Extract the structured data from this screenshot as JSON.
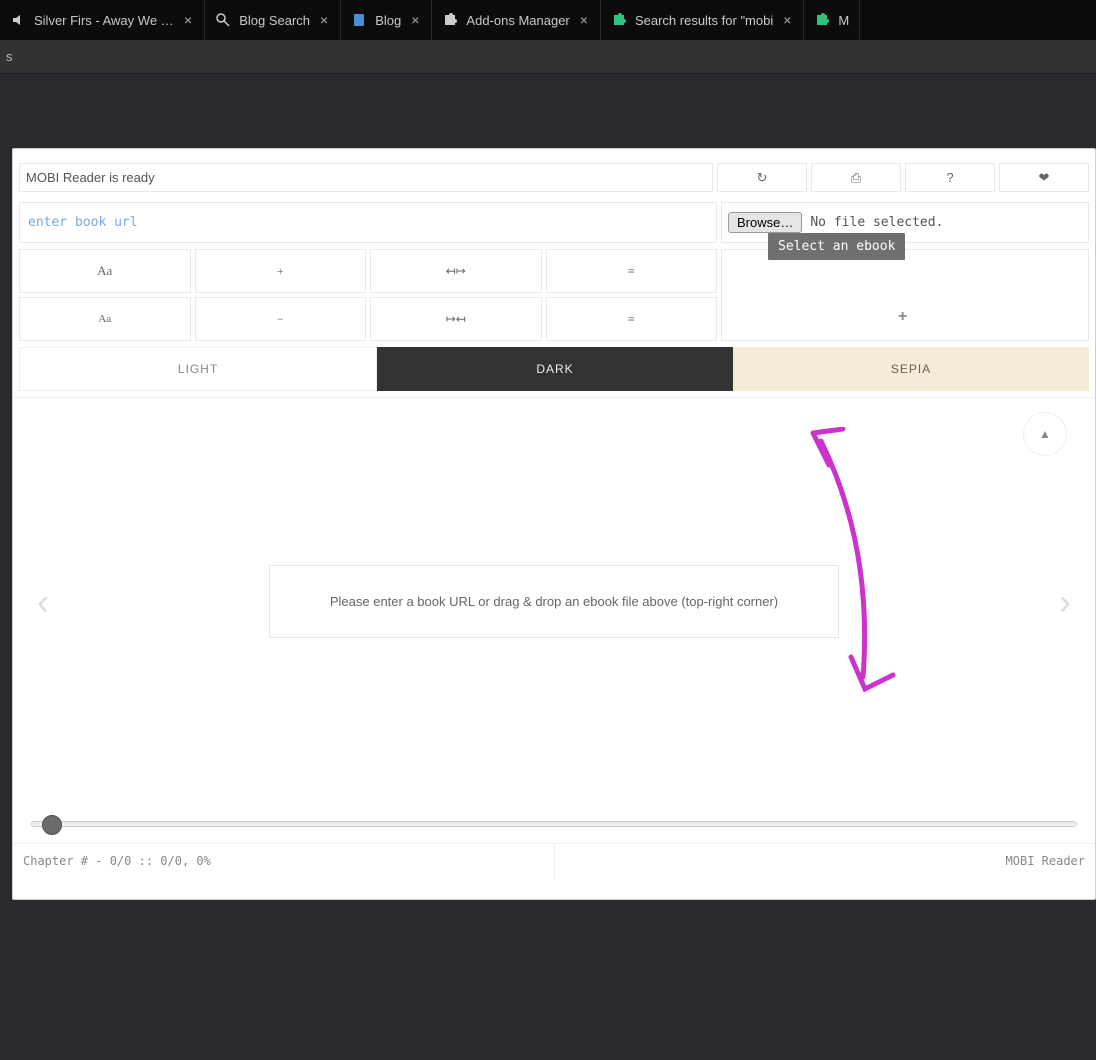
{
  "tabs": [
    {
      "label": "Silver Firs - Away We Go",
      "favicon": "audio"
    },
    {
      "label": "Blog Search",
      "favicon": "search"
    },
    {
      "label": "Blog",
      "favicon": "doc"
    },
    {
      "label": "Add-ons Manager",
      "favicon": "puzzle"
    },
    {
      "label": "Search results for \"mobi",
      "favicon": "puzzle-green"
    },
    {
      "label": "M",
      "favicon": "puzzle-green"
    }
  ],
  "toolbar_stub": "s",
  "status": "MOBI Reader is ready",
  "url_placeholder": "enter book url",
  "browse_label": "Browse…",
  "file_status": "No file selected.",
  "tooltip": "Select an ebook",
  "icons": {
    "reload": "↻",
    "print": "⎙",
    "help": "?",
    "heart": "❤",
    "font_big": "Aa",
    "font_small": "Aa",
    "plus": "+",
    "minus": "−",
    "widen": "↤↦",
    "narrow": "↦↤",
    "lh_inc": "≡",
    "lh_dec": "≡"
  },
  "themes": {
    "light": "LIGHT",
    "dark": "DARK",
    "sepia": "SEPIA"
  },
  "nav": {
    "prev": "‹",
    "next": "›",
    "top": "▲"
  },
  "empty_message": "Please enter a book URL or drag & drop an ebook file above (top-right corner)",
  "footer": {
    "left": "Chapter # - 0/0 :: 0/0, 0%",
    "right": "MOBI Reader"
  },
  "plus_indicator": "+"
}
